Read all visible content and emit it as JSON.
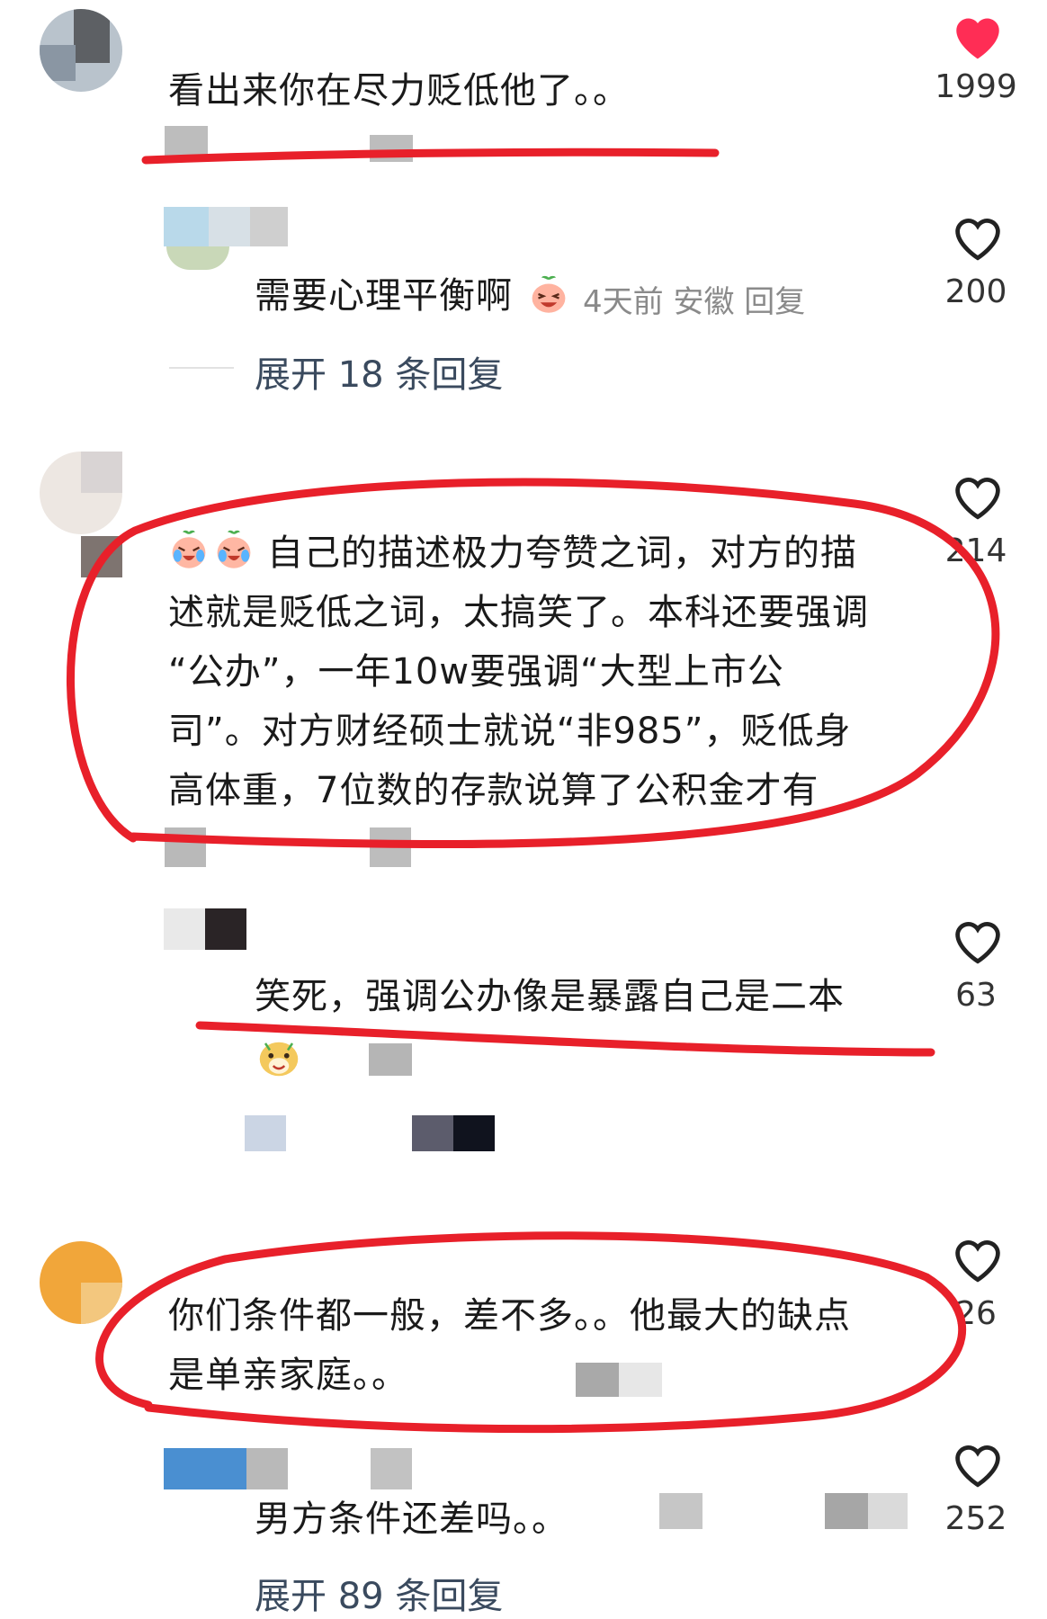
{
  "comments": [
    {
      "text": "看出来你在尽力贬低他了。。",
      "likes": "1999",
      "liked": true
    },
    {
      "text": "需要心理平衡啊",
      "meta": "4天前 安徽 回复",
      "likes": "200",
      "expand": "展开 18 条回复"
    },
    {
      "lines": [
        "自己的描述极力夸赞之词，对方的描",
        "述就是贬低之词，太搞笑了。本科还要强调",
        "“公办”，一年10w要强调“大型上市公",
        "司”。对方财经硕士就说“非985”，贬低身",
        "高体重，7位数的存款说算了公积金才有"
      ],
      "likes": "214"
    },
    {
      "text": "笑死，强调公办像是暴露自己是二本",
      "likes": "63"
    },
    {
      "lines": [
        "你们条件都一般，差不多。。他最大的缺点",
        "是单亲家庭。。"
      ],
      "likes": "26"
    },
    {
      "text": "男方条件还差吗。。",
      "likes": "252",
      "expand": "展开 89 条回复"
    }
  ],
  "colors": {
    "heart_liked": "#ff2d55",
    "annotation": "#e8202a",
    "meta": "#8a8a8a"
  },
  "icons": [
    "heart-icon",
    "heart-filled-icon",
    "laugh-cry-emoji",
    "peach-laugh-emoji",
    "dog-emoji"
  ]
}
